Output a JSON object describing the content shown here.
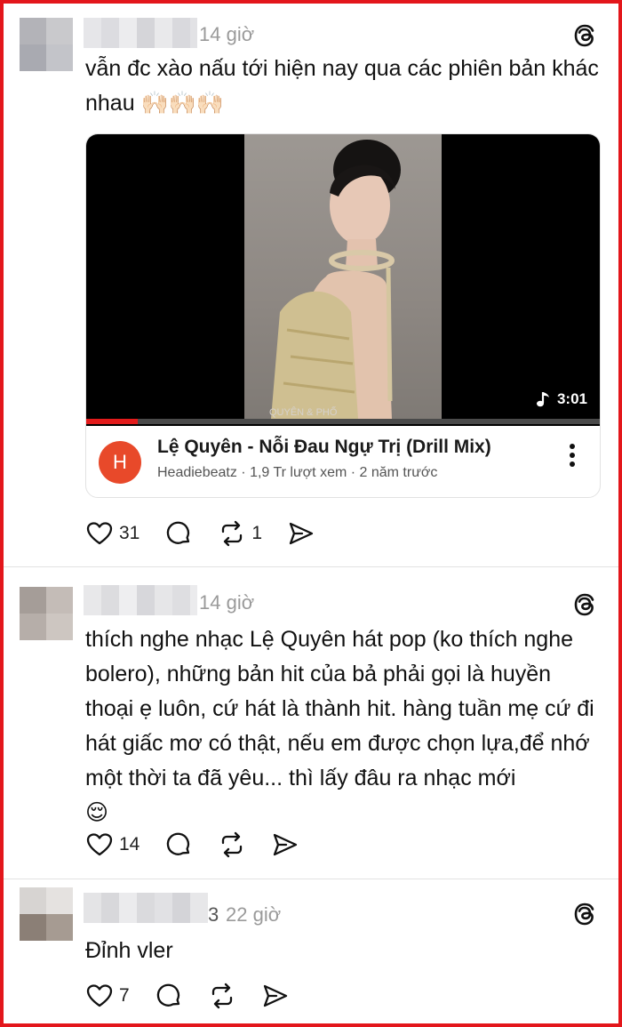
{
  "posts": [
    {
      "time": "14 giờ",
      "text": "vẫn đc xào nấu tới hiện nay qua các phiên bản khác nhau 🙌🏻🙌🏻🙌🏻",
      "likes": "31",
      "reposts": "1",
      "avatar_colors": [
        "#b3b3b8",
        "#c9c9cc",
        "#a9aab1",
        "#c3c4c9"
      ],
      "username_colors": [
        "#e6e6e9",
        "#dcdce0",
        "#ececee",
        "#d5d5d9",
        "#e9e9eb",
        "#d9d9dd",
        "#e2e2e5"
      ],
      "video": {
        "title": "Lệ Quyên - Nỗi Đau Ngự Trị (Drill Mix)",
        "channel_initial": "H",
        "meta": "Headiebeatz · 1,9 Tr lượt xem · 2 năm trước",
        "duration": "3:01",
        "watermark": "QUYÊN & PHỐ",
        "progress": 0.1
      }
    },
    {
      "time": "14 giờ",
      "text": "thích nghe nhạc Lệ Quyên hát pop (ko thích nghe bolero), những bản hit của bả phải gọi là huyền thoại ẹ luôn, cứ hát là thành hit. hàng tuần mẹ cứ đi hát giấc mơ có thật, nếu em được chọn lựa,để nhớ một thời ta đã yêu... thì lấy đâu ra nhạc mới",
      "emoji": "😌",
      "likes": "14",
      "avatar_colors": [
        "#a59d98",
        "#c4bcb7",
        "#b6aea9",
        "#cdc6c1"
      ],
      "username_colors": [
        "#e8e8ea",
        "#dcdcdf",
        "#eeeef0",
        "#d7d7db",
        "#e6e6e8",
        "#dedee1",
        "#ebebed"
      ]
    },
    {
      "time": "22 giờ",
      "username_fragment": "3",
      "text": "Đỉnh vler",
      "likes": "7",
      "avatar_colors": [
        "#d7d4d2",
        "#e5e2e0",
        "#8b7f76",
        "#a69b92"
      ],
      "username_colors": [
        "#e4e4e6",
        "#d8d8db",
        "#ebebed",
        "#dadadd",
        "#e1e1e4",
        "#d4d4d8",
        "#e7e7e9"
      ]
    }
  ]
}
